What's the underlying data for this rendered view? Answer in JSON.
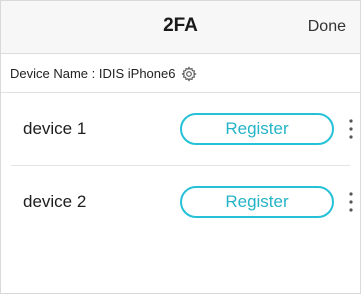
{
  "header": {
    "title": "2FA",
    "done_label": "Done"
  },
  "device_name_bar": {
    "label": "Device Name : IDIS iPhone6",
    "icon": "gear-icon"
  },
  "devices": [
    {
      "name": "device 1",
      "button_label": "Register",
      "menu_icon": "more-vertical-icon"
    },
    {
      "name": "device 2",
      "button_label": "Register",
      "menu_icon": "more-vertical-icon"
    }
  ],
  "colors": {
    "accent": "#25c1d6",
    "header_bg": "#f7f7f7"
  }
}
